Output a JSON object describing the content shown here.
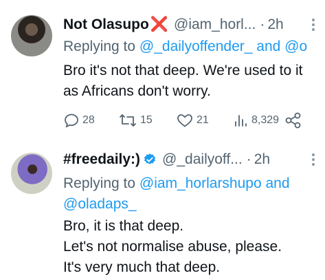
{
  "tweet1": {
    "display_name": "Not Olasupo",
    "name_emoji": "❌",
    "handle": "@iam_horl...",
    "sep": "·",
    "time": "2h",
    "replying_prefix": "Replying to ",
    "replying_users": "@_dailyoffender_ and @o",
    "body_lines": [
      "Bro it's not that deep. We're used to it",
      "as Africans don't worry."
    ],
    "replies": "28",
    "retweets": "15",
    "likes": "21",
    "views": "8,329"
  },
  "tweet2": {
    "display_name": "#freedaily:)",
    "verified": true,
    "handle": "@_dailyoff...",
    "sep": "·",
    "time": "2h",
    "replying_prefix": "Replying to ",
    "replying_line1": "@iam_horlarshupo and",
    "replying_line2": "@oladaps_",
    "body_lines": [
      "Bro, it is that deep.",
      "Let's not normalise abuse, please.",
      "It's very much that deep."
    ]
  },
  "colors": {
    "link": "#1d9bf0",
    "muted": "#536471",
    "text": "#0f1419",
    "verified": "#1d9bf0"
  }
}
